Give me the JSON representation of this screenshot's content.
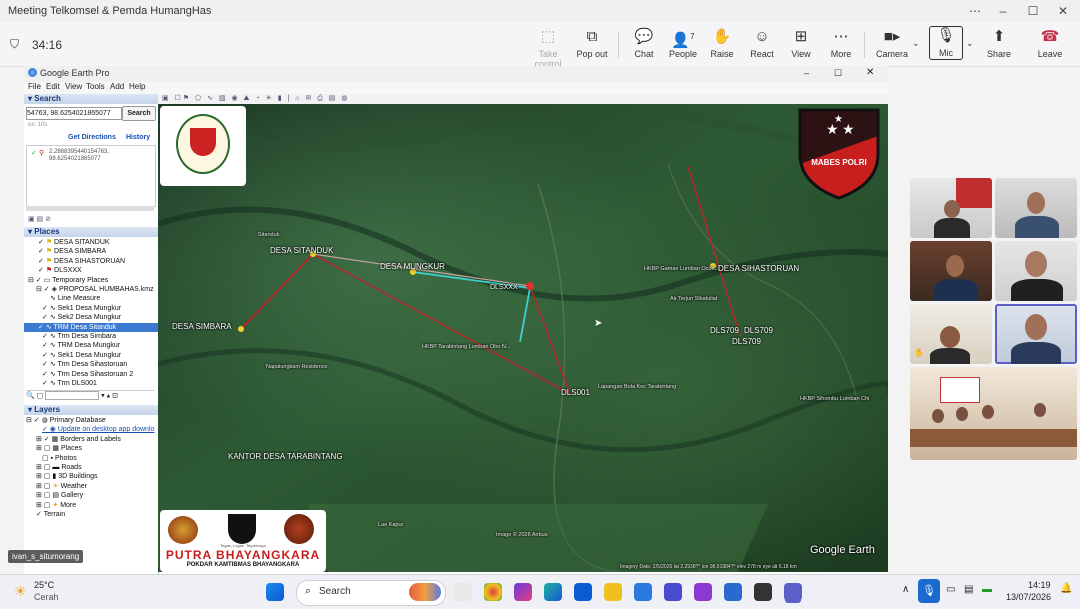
{
  "window": {
    "title": "Meeting Telkomsel & Pemda HumangHas"
  },
  "toolbar": {
    "timer": "34:16",
    "take_control": "Take control",
    "pop_out": "Pop out",
    "chat": "Chat",
    "people": "People",
    "people_count": "7",
    "raise": "Raise",
    "react": "React",
    "view": "View",
    "more": "More",
    "camera": "Camera",
    "mic": "Mic",
    "share": "Share",
    "leave": "Leave"
  },
  "earth": {
    "app_title": "Google Earth Pro",
    "menu": [
      "File",
      "Edit",
      "View",
      "Tools",
      "Add",
      "Help"
    ],
    "search": {
      "header": "Search",
      "input_value": "54763, 98.6254021865077",
      "button": "Search",
      "hint": "ex: 10s",
      "get_directions": "Get Directions",
      "history": "History",
      "result_line1": "2.2888395440154763,",
      "result_line2": "98.6254021865077"
    },
    "places": {
      "header": "Places",
      "items": [
        "DESA SITANDUK",
        "DESA SIMBARA",
        "DESA SIHASTORUAN",
        "DLSXXX",
        "Temporary Places",
        "PROPOSAL HUMBAHAS.kmz",
        "Line Measure",
        "Sek1 Desa Mungkur",
        "Sek2 Desa Mungkur",
        "TRM Desa Sitanduk",
        "Trm Desa Simbara",
        "TRM Desa Mungkur",
        "Sek1 Desa Mungkur",
        "Trm Desa Sihastoruan",
        "Trm Desa Sihastoruan 2",
        "Trm DLS001"
      ]
    },
    "layers": {
      "header": "Layers",
      "items": [
        "Primary Database",
        "Update on desktop app downlo",
        "Borders and Labels",
        "Places",
        "Photos",
        "Roads",
        "3D Buildings",
        "Weather",
        "Gallery",
        "More",
        "Terrain"
      ]
    },
    "map_labels": {
      "sitanduk": "DESA SITANDUK",
      "mungkur": "DESA MUNGKUR",
      "simbara": "DESA SIMBARA",
      "sihastoruan": "DESA SIHASTORUAN",
      "dlsxxx": "DLSXXX",
      "dls001": "DLS001",
      "dls709a": "DLS709",
      "dls709b": "DLS709",
      "dls709c": "DLS709",
      "kantor": "KANTOR DESA TARABINTANG",
      "church1": "HKBP Tarabintang Lumban Obo N...",
      "church2": "HKBP Gaman Lumban Ocon...",
      "church3": "HKBP Sihombu Lumban Chi",
      "lapangan": "Lapangan Bola Kec Tarabintang",
      "napa": "Napalungkam Residence",
      "airsang": "Air Terjun Sibatuliat",
      "lae": "Lae Kapur",
      "sitanduk_small": "Sitanduk",
      "copyright": "Image © 2026 Airbus",
      "status": "Imagery Date: 2/5/2026   lat 2.2938?°  lon 98.61984?°  elev 278 m   eye alt 6.18 km",
      "brand": "Google Earth"
    },
    "overlays": {
      "mabes_text": "MABES POLRI",
      "banner_title": "PUTRA BHAYANGKARA",
      "banner_sub": "POKDAR KAMTIBMAS BHAYANGKARA",
      "banner_motto": "Tegas, Lugas, Terpercaya"
    }
  },
  "presenter_tag": "ivan_s_situmorang",
  "taskbar": {
    "weather_temp": "25°C",
    "weather_desc": "Cerah",
    "search_placeholder": "Search",
    "time": "14:19",
    "date": "13/07/2026"
  },
  "colors": {
    "accent": "#5b5fc7",
    "leave": "#c4314b",
    "sky": "#1a2a1a"
  }
}
